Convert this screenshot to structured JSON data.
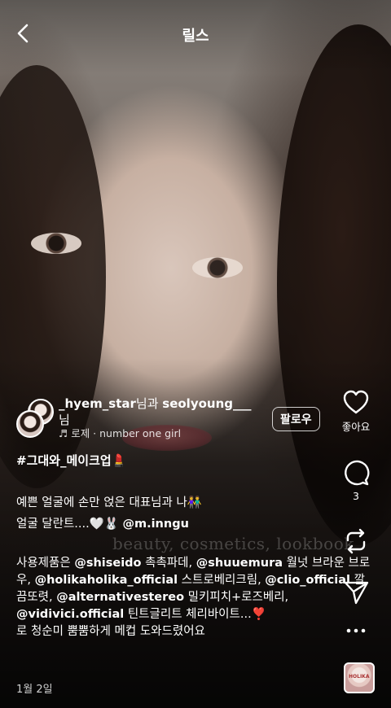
{
  "header": {
    "title": "릴스"
  },
  "watermark": "beauty, cosmetics, lookbook",
  "author": {
    "username1": "_hyem_star",
    "connector": "님과 ",
    "username2": "seolyoung___",
    "suffix": "님",
    "music": "로제 · number one girl",
    "follow_label": "팔로우"
  },
  "caption": {
    "hashtag": "#그대와_메이크업💄",
    "line1": "예쁜 얼굴에 손만 얹은 대표님과 나👫",
    "line2_text": "얼굴 달란트....🤍🐰 ",
    "line2_mention": "@m.inngu",
    "products": [
      {
        "t": "사용제품은 ",
        "b": false
      },
      {
        "t": "@shiseido",
        "b": true
      },
      {
        "t": " 촉촉파데, ",
        "b": false
      },
      {
        "t": "@shuuemura",
        "b": true
      },
      {
        "t": " 월넛 브라운 브로우, ",
        "b": false
      },
      {
        "t": "@holikaholika_official",
        "b": true
      },
      {
        "t": " 스트로베리크림, ",
        "b": false
      },
      {
        "t": "@clio_official",
        "b": true
      },
      {
        "t": " 깔끔또렷, ",
        "b": false
      },
      {
        "t": "@alternativestereo",
        "b": true
      },
      {
        "t": " 밀키피치+로즈베리, ",
        "b": false
      },
      {
        "t": "@vidivici.official",
        "b": true
      },
      {
        "t": " 틴트글리트 체리바이트...❣️",
        "b": false
      }
    ],
    "last_line": "로 청순미 뿜뿜하게 메컵 도와드렸어요"
  },
  "date": "1월 2일",
  "actions": {
    "like_label": "좋아요",
    "comment_count": "3"
  },
  "thumbnail_text": "HOLIKA"
}
